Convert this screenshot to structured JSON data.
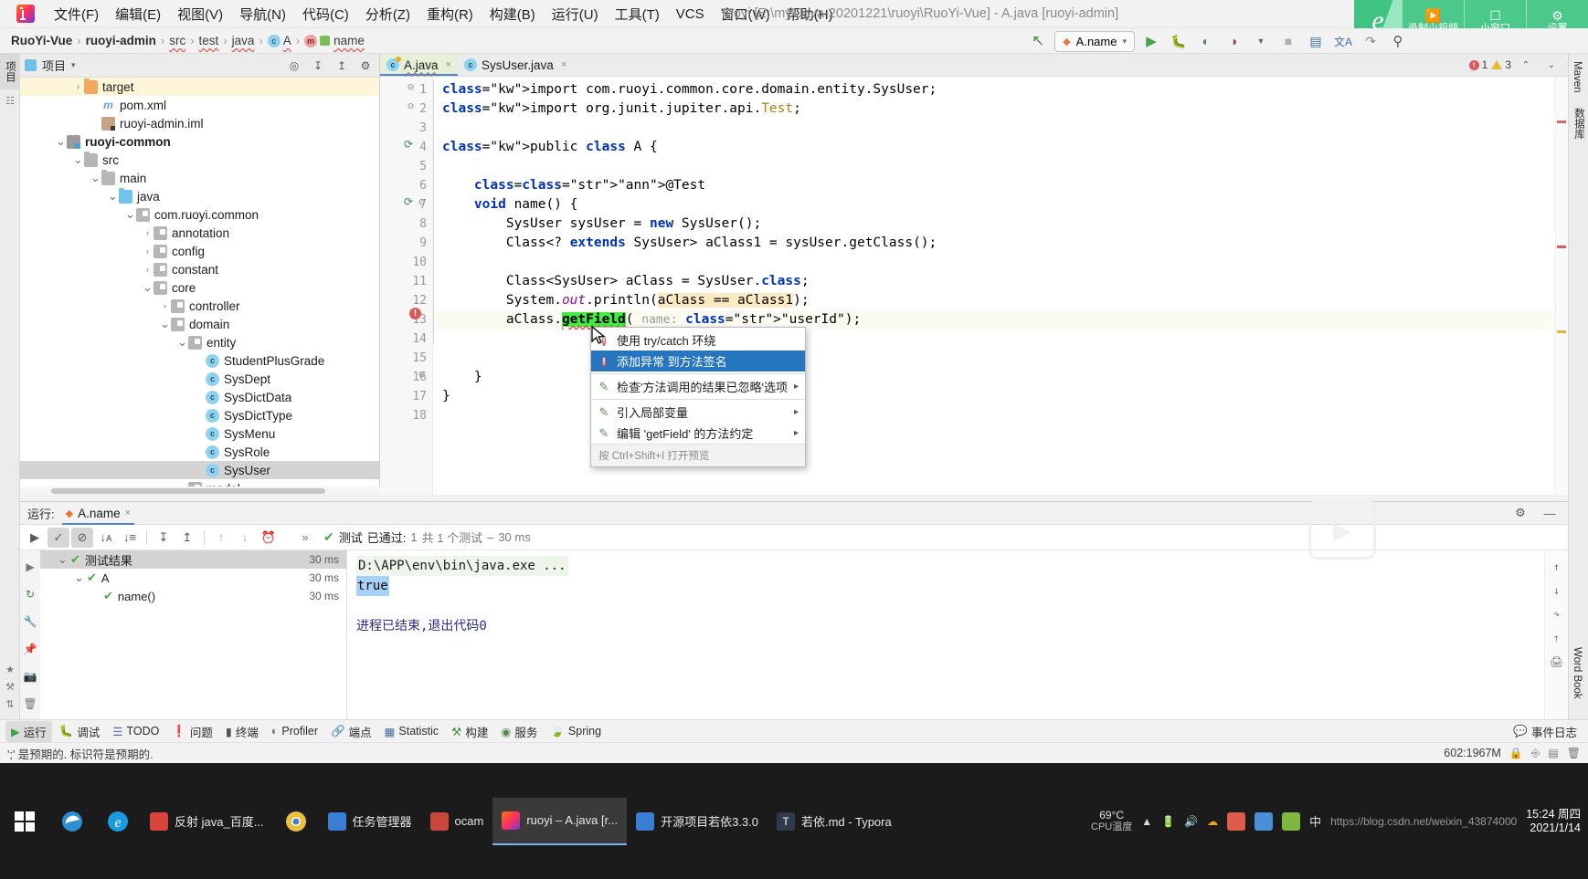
{
  "menubar": {
    "app_name": "IntelliJ IDEA",
    "items": [
      {
        "label": "文件(F)"
      },
      {
        "label": "编辑(E)"
      },
      {
        "label": "视图(V)"
      },
      {
        "label": "导航(N)"
      },
      {
        "label": "代码(C)"
      },
      {
        "label": "分析(Z)"
      },
      {
        "label": "重构(R)"
      },
      {
        "label": "构建(B)"
      },
      {
        "label": "运行(U)"
      },
      {
        "label": "工具(T)"
      },
      {
        "label": "VCS"
      },
      {
        "label": "窗口(W)"
      },
      {
        "label": "帮助(H)"
      }
    ],
    "window_title": "ruoyi [E:\\my-Java-20201221\\ruoyi\\RuoYi-Vue] - A.java [ruoyi-admin]"
  },
  "recorder_overlay": {
    "brand_glyph": "e",
    "buttons": [
      {
        "icon": "video-record-icon",
        "label": "录制小视频"
      },
      {
        "icon": "small-window-icon",
        "label": "小窗口"
      },
      {
        "icon": "gear-icon",
        "label": "设置"
      }
    ],
    "accent": "#4bc98a"
  },
  "breadcrumb": {
    "items": [
      {
        "label": "RuoYi-Vue",
        "bold": true
      },
      {
        "label": "ruoyi-admin",
        "bold": true
      },
      {
        "label": "src",
        "bold": false
      },
      {
        "label": "test",
        "bold": false
      },
      {
        "label": "java",
        "bold": false
      },
      {
        "label": "A",
        "bold": false,
        "icon": "class-icon"
      },
      {
        "label": "name",
        "bold": false,
        "icon": "method-icon"
      }
    ],
    "separator": "›"
  },
  "toolbar": {
    "back_arrow": "↖",
    "run_config": "A.name",
    "run_config_caret": "▾",
    "run_icon": "▶",
    "debug_icon": "debug-icon",
    "coverage_icon": "coverage-icon",
    "profile_icon": "profile-icon",
    "stop_icon": "■",
    "layout_icon": "layout-icon",
    "translate_icon": "文A",
    "update_icon": "update-icon",
    "search_icon": "⌕"
  },
  "left_strip": {
    "tabs": [
      {
        "label": "项目",
        "active": true
      },
      {
        "label": "structure-icon",
        "active": false
      }
    ],
    "bottom_icons": [
      "favorites-star-icon",
      "build-icon",
      "commit-icon"
    ]
  },
  "right_strip": {
    "tabs": [
      {
        "label": "Maven"
      },
      {
        "label": "数据库"
      },
      {
        "label": "Word Book"
      }
    ]
  },
  "project_panel": {
    "title": "项目",
    "title_caret": "▾",
    "header_icons": [
      "locate-icon",
      "expand-all-icon",
      "collapse-all-icon",
      "gear-icon"
    ],
    "tree": [
      {
        "label": "target",
        "indent": 3,
        "arrow": "›",
        "icon": "folder-orange",
        "highlight": true
      },
      {
        "label": "pom.xml",
        "indent": 4,
        "arrow": "",
        "icon": "maven-m",
        "highlight": false
      },
      {
        "label": "ruoyi-admin.iml",
        "indent": 4,
        "arrow": "",
        "icon": "iml-file",
        "highlight": false
      },
      {
        "label": "ruoyi-common",
        "indent": 2,
        "arrow": "⌄",
        "icon": "module",
        "bold": true,
        "highlight": false
      },
      {
        "label": "src",
        "indent": 3,
        "arrow": "⌄",
        "icon": "folder-gray",
        "highlight": false
      },
      {
        "label": "main",
        "indent": 4,
        "arrow": "⌄",
        "icon": "folder-gray",
        "highlight": false
      },
      {
        "label": "java",
        "indent": 5,
        "arrow": "⌄",
        "icon": "folder-blue",
        "highlight": false
      },
      {
        "label": "com.ruoyi.common",
        "indent": 6,
        "arrow": "⌄",
        "icon": "package",
        "highlight": false
      },
      {
        "label": "annotation",
        "indent": 7,
        "arrow": "›",
        "icon": "package",
        "highlight": false
      },
      {
        "label": "config",
        "indent": 7,
        "arrow": "›",
        "icon": "package",
        "highlight": false
      },
      {
        "label": "constant",
        "indent": 7,
        "arrow": "›",
        "icon": "package",
        "highlight": false
      },
      {
        "label": "core",
        "indent": 7,
        "arrow": "⌄",
        "icon": "package",
        "highlight": false
      },
      {
        "label": "controller",
        "indent": 8,
        "arrow": "›",
        "icon": "package",
        "highlight": false
      },
      {
        "label": "domain",
        "indent": 8,
        "arrow": "⌄",
        "icon": "package",
        "highlight": false
      },
      {
        "label": "entity",
        "indent": 9,
        "arrow": "⌄",
        "icon": "package",
        "highlight": false
      },
      {
        "label": "StudentPlusGrade",
        "indent": 10,
        "arrow": "",
        "icon": "class",
        "highlight": false
      },
      {
        "label": "SysDept",
        "indent": 10,
        "arrow": "",
        "icon": "class",
        "highlight": false
      },
      {
        "label": "SysDictData",
        "indent": 10,
        "arrow": "",
        "icon": "class",
        "highlight": false
      },
      {
        "label": "SysDictType",
        "indent": 10,
        "arrow": "",
        "icon": "class",
        "highlight": false
      },
      {
        "label": "SysMenu",
        "indent": 10,
        "arrow": "",
        "icon": "class",
        "highlight": false
      },
      {
        "label": "SysRole",
        "indent": 10,
        "arrow": "",
        "icon": "class",
        "highlight": false
      },
      {
        "label": "SysUser",
        "indent": 10,
        "arrow": "",
        "icon": "class",
        "selected": true,
        "highlight": false
      },
      {
        "label": "model",
        "indent": 9,
        "arrow": "›",
        "icon": "package",
        "highlight": false
      }
    ]
  },
  "editor": {
    "tabs": [
      {
        "label": "A.java",
        "active": true,
        "modified": true,
        "icon": "java-class-icon",
        "close": "×"
      },
      {
        "label": "SysUser.java",
        "active": false,
        "modified": false,
        "icon": "java-class-icon",
        "close": "×"
      }
    ],
    "inspections": {
      "errors": "1",
      "warnings": "3",
      "error_glyph": "!",
      "up": "⌃",
      "down": "⌄"
    },
    "lines": [
      {
        "n": 1,
        "text": "import com.ruoyi.common.core.domain.entity.SysUser;"
      },
      {
        "n": 2,
        "text": "import org.junit.jupiter.api.Test;"
      },
      {
        "n": 3,
        "text": ""
      },
      {
        "n": 4,
        "text": "public class A {"
      },
      {
        "n": 5,
        "text": ""
      },
      {
        "n": 6,
        "text": "    @Test"
      },
      {
        "n": 7,
        "text": "    void name() {"
      },
      {
        "n": 8,
        "text": "        SysUser sysUser = new SysUser();"
      },
      {
        "n": 9,
        "text": "        Class<? extends SysUser> aClass1 = sysUser.getClass();"
      },
      {
        "n": 10,
        "text": ""
      },
      {
        "n": 11,
        "text": "        Class<SysUser> aClass = SysUser.class;"
      },
      {
        "n": 12,
        "text": "        System.out.println(aClass == aClass1);"
      },
      {
        "n": 13,
        "text": "        aClass.getField( name: \"userId\");"
      },
      {
        "n": 14,
        "text": ""
      },
      {
        "n": 15,
        "text": ""
      },
      {
        "n": 16,
        "text": "    }"
      },
      {
        "n": 17,
        "text": "}"
      },
      {
        "n": 18,
        "text": ""
      }
    ],
    "param_hint": "name:",
    "highlighted_symbol": "getField"
  },
  "context_menu": {
    "items": [
      {
        "label": "使用 try/catch 环绕",
        "icon": "error-bulb-icon",
        "selected": false,
        "submenu": false
      },
      {
        "label": "添加异常 到方法签名",
        "icon": "error-bulb-icon",
        "selected": true,
        "submenu": false
      },
      {
        "sep": true
      },
      {
        "label": "检查'方法调用的结果已忽略'选项",
        "icon": "quickfix-icon",
        "selected": false,
        "submenu": true
      },
      {
        "sep": true
      },
      {
        "label": "引入局部变量",
        "icon": "refactor-icon",
        "selected": false,
        "submenu": true
      },
      {
        "label": "编辑 'getField' 的方法约定",
        "icon": "quickfix-icon",
        "selected": false,
        "submenu": true
      }
    ],
    "hint": "按 Ctrl+Shift+I 打开预览",
    "submenu_arrow": "▸",
    "selected_bg": "#2675bf"
  },
  "run_panel": {
    "label": "运行:",
    "tab": "A.name",
    "tab_close": "×",
    "toolbar_icons": [
      {
        "name": "rerun-icon",
        "glyph": "▶"
      },
      {
        "name": "show-passed-icon",
        "glyph": "✓",
        "on": true
      },
      {
        "name": "hide-ignored-icon",
        "glyph": "⊘",
        "on": true
      },
      {
        "name": "sort-alpha-icon",
        "glyph": "↓ᴀ"
      },
      {
        "name": "sort-duration-icon",
        "glyph": "↓≡"
      },
      {
        "name": "expand-all-icon",
        "glyph": "↧"
      },
      {
        "name": "collapse-all-icon",
        "glyph": "↥"
      },
      {
        "name": "prev-failed-icon",
        "glyph": "↑",
        "dim": true
      },
      {
        "name": "next-failed-icon",
        "glyph": "↓",
        "dim": true
      },
      {
        "name": "history-icon",
        "glyph": "⌚"
      },
      {
        "name": "more-icon",
        "glyph": "»"
      }
    ],
    "status": {
      "check": "✔",
      "prefix": "测试",
      "passed": "已通过:",
      "count": "1",
      "of": "共 1 个测试",
      "dash": "–",
      "duration": "30 ms"
    },
    "tree": [
      {
        "label": "测试结果",
        "time": "30 ms",
        "indent": 1,
        "arrow": "⌄",
        "selected": true,
        "status": "pass"
      },
      {
        "label": "A",
        "time": "30 ms",
        "indent": 2,
        "arrow": "⌄",
        "selected": false,
        "status": "pass"
      },
      {
        "label": "name()",
        "time": "30 ms",
        "indent": 3,
        "arrow": "",
        "selected": false,
        "status": "pass"
      }
    ],
    "console": [
      {
        "text": "D:\\APP\\env\\bin\\java.exe ...",
        "style": "cmd"
      },
      {
        "text": "true",
        "style": "selected"
      },
      {
        "text": "",
        "style": "plain"
      },
      {
        "text": "进程已结束,退出代码0",
        "style": "exit"
      }
    ],
    "side_icons": [
      "up-arrow-icon",
      "down-arrow-icon",
      "wrap-text-icon",
      "export-icon",
      "print-icon"
    ],
    "left_icons": [
      "rerun-icon",
      "rerun-failed-icon",
      "settings-wrench-icon",
      "pin-icon",
      "camera-icon",
      "delete-icon"
    ]
  },
  "bottom_bar": {
    "items": [
      {
        "label": "运行",
        "icon": "run-icon",
        "active": true
      },
      {
        "label": "调试",
        "icon": "debug-icon",
        "active": false
      },
      {
        "label": "TODO",
        "icon": "todo-icon",
        "active": false
      },
      {
        "label": "问题",
        "icon": "problems-icon",
        "active": false
      },
      {
        "label": "终端",
        "icon": "terminal-icon",
        "active": false
      },
      {
        "label": "Profiler",
        "icon": "profiler-icon",
        "active": false
      },
      {
        "label": "端点",
        "icon": "endpoints-icon",
        "active": false
      },
      {
        "label": "Statistic",
        "icon": "statistic-icon",
        "active": false
      },
      {
        "label": "构建",
        "icon": "build-icon",
        "active": false
      },
      {
        "label": "服务",
        "icon": "services-icon",
        "active": false
      },
      {
        "label": "Spring",
        "icon": "spring-icon",
        "active": false
      }
    ],
    "right": {
      "label": "事件日志",
      "icon": "event-log-icon"
    }
  },
  "status_bar": {
    "message": "';' 是预期的. 标识符是预期的.",
    "caret_position": "602:1967M",
    "icons": [
      "lock-icon",
      "branch-icon",
      "layout-icon",
      "trash-icon"
    ]
  },
  "taskbar": {
    "start_icon": "windows-start-icon",
    "search_icon": "search-icon",
    "task_view_icon": "task-view-icon",
    "apps": [
      {
        "label": "反射 java_百度...",
        "icon_color": "#d8443c",
        "active": false
      },
      {
        "label": "",
        "icon_color": "#e8c13a",
        "active": false
      },
      {
        "label": "任务管理器",
        "icon_color": "#3b7fd4",
        "active": false
      },
      {
        "label": "ocam",
        "icon_color": "#c8473a",
        "active": false
      },
      {
        "label": "ruoyi – A.java [r...",
        "icon_color": "#f0682a",
        "active": true
      },
      {
        "label": "开源项目若依3.3.0",
        "icon_color": "#3b7fd4",
        "active": false
      },
      {
        "label": "若依.md - Typora",
        "icon_color": "#2f3b4a",
        "active": false
      }
    ],
    "tray": {
      "temp_value": "69°C",
      "temp_label": "CPU温度",
      "icons": [
        "up-chevron-icon",
        "battery-icon",
        "speaker-icon",
        "network-icon",
        "cloud-icon",
        "app-icon-1",
        "app-icon-2",
        "app-icon-3",
        "ime-icon"
      ],
      "ime": "中",
      "time": "15:24 周四",
      "date": "2021/1/14",
      "watermark": "https://blog.csdn.net/weixin_43874000"
    }
  }
}
